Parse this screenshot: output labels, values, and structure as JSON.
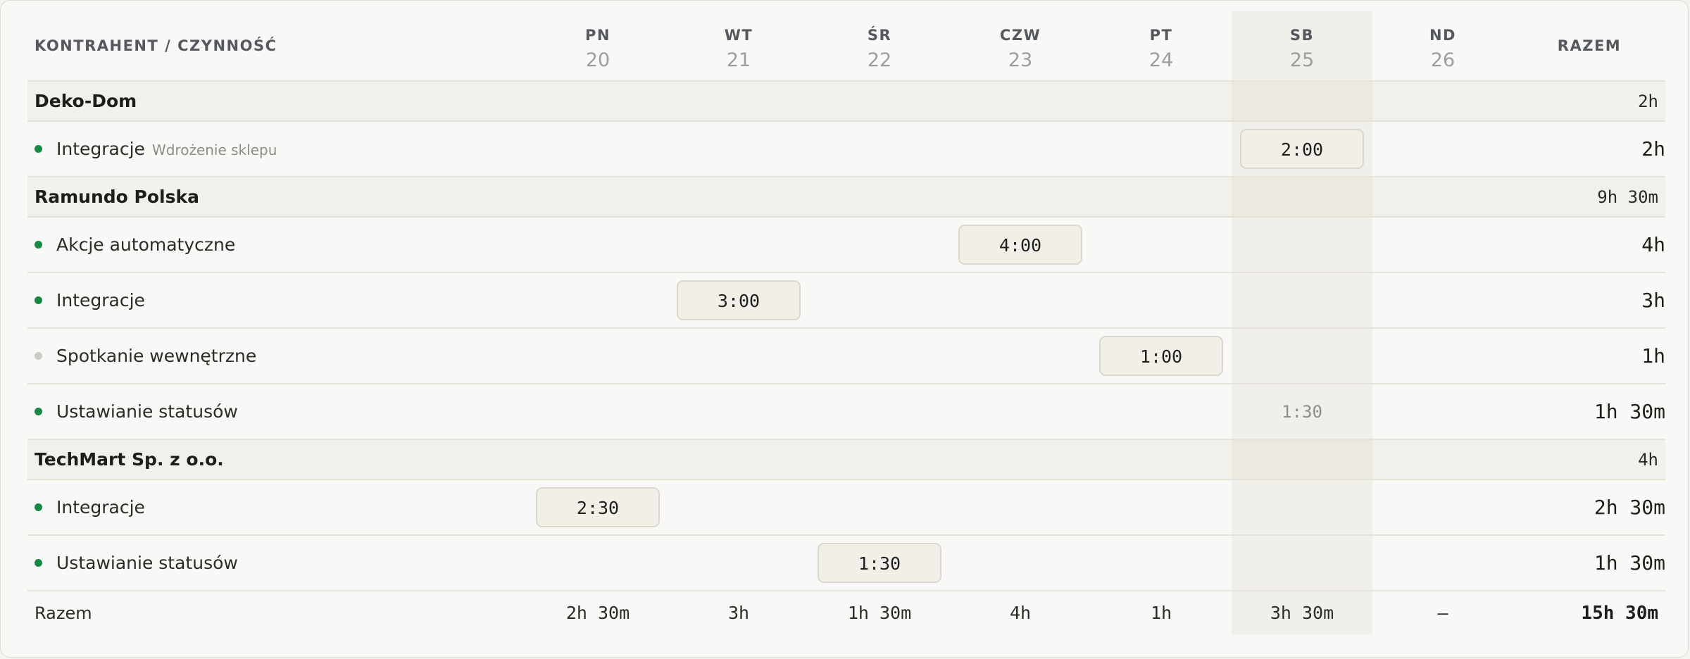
{
  "header": {
    "label": "KONTRAHENT / CZYNNOŚĆ",
    "total_label": "RAZEM",
    "days": [
      {
        "name": "PN",
        "num": "20"
      },
      {
        "name": "WT",
        "num": "21"
      },
      {
        "name": "ŚR",
        "num": "22"
      },
      {
        "name": "CZW",
        "num": "23"
      },
      {
        "name": "PT",
        "num": "24"
      },
      {
        "name": "SB",
        "num": "25"
      },
      {
        "name": "ND",
        "num": "26"
      }
    ]
  },
  "groups": [
    {
      "name": "Deko-Dom",
      "total": "2h",
      "rows": [
        {
          "name": "Integracje",
          "sub": "Wdrożenie sklepu",
          "dot": "green",
          "total": "2h",
          "cells": [
            "",
            "",
            "",
            "",
            "",
            "2:00",
            ""
          ]
        }
      ]
    },
    {
      "name": "Ramundo Polska",
      "total": "9h 30m",
      "rows": [
        {
          "name": "Akcje automatyczne",
          "dot": "green",
          "total": "4h",
          "cells": [
            "",
            "",
            "",
            "4:00",
            "",
            "",
            ""
          ]
        },
        {
          "name": "Integracje",
          "dot": "green",
          "total": "3h",
          "cells": [
            "",
            "3:00",
            "",
            "",
            "",
            "",
            ""
          ]
        },
        {
          "name": "Spotkanie wewnętrzne",
          "dot": "grey",
          "total": "1h",
          "cells": [
            "",
            "",
            "",
            "",
            "1:00",
            "",
            ""
          ]
        },
        {
          "name": "Ustawianie statusów",
          "dot": "green",
          "total": "1h 30m",
          "cells": [
            "",
            "",
            "",
            "",
            "",
            "1:30",
            ""
          ],
          "ghost_day": 5
        }
      ]
    },
    {
      "name": "TechMart Sp. z o.o.",
      "total": "4h",
      "rows": [
        {
          "name": "Integracje",
          "dot": "green",
          "total": "2h 30m",
          "cells": [
            "2:30",
            "",
            "",
            "",
            "",
            "",
            ""
          ]
        },
        {
          "name": "Ustawianie statusów",
          "dot": "green",
          "total": "1h 30m",
          "cells": [
            "",
            "",
            "1:30",
            "",
            "",
            "",
            ""
          ]
        }
      ]
    }
  ],
  "footer": {
    "label": "Razem",
    "days": [
      "2h 30m",
      "3h",
      "1h 30m",
      "4h",
      "1h",
      "3h 30m",
      "–"
    ],
    "grand_total": "15h 30m"
  },
  "colors": {
    "dot_green": "#158a45",
    "dot_grey": "#cdccc3",
    "weekend_highlight": "#f0efe9"
  }
}
